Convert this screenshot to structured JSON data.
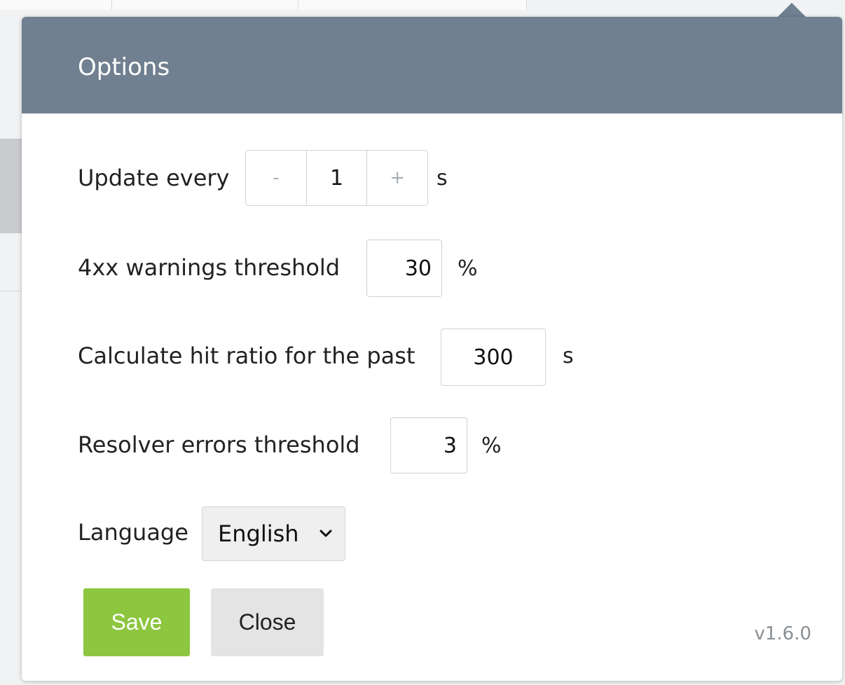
{
  "popup": {
    "title": "Options",
    "header_color": "#708090"
  },
  "update_every": {
    "label": "Update every",
    "decrement": "-",
    "value": "1",
    "increment": "+",
    "unit": "s"
  },
  "warnings_4xx": {
    "label": "4xx warnings threshold",
    "value": "30",
    "unit": "%"
  },
  "hit_ratio": {
    "label": "Calculate hit ratio for the past",
    "value": "300",
    "unit": "s"
  },
  "resolver_errors": {
    "label": "Resolver errors threshold",
    "value": "3",
    "unit": "%"
  },
  "language": {
    "label": "Language",
    "selected": "English",
    "icon": "chevron-down-icon"
  },
  "buttons": {
    "save_label": "Save",
    "save_color": "#8dc63f",
    "close_label": "Close"
  },
  "version": "v1.6.0"
}
